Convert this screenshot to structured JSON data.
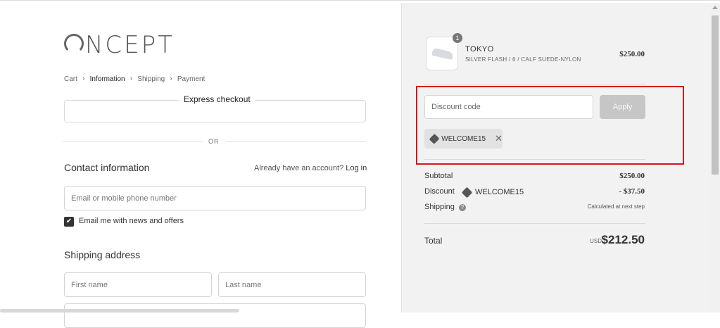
{
  "logo": {
    "text": "NCEPT"
  },
  "breadcrumb": [
    {
      "label": "Cart",
      "active": false
    },
    {
      "label": "Information",
      "active": true
    },
    {
      "label": "Shipping",
      "active": false
    },
    {
      "label": "Payment",
      "active": false
    }
  ],
  "express": {
    "label": "Express checkout",
    "or": "OR"
  },
  "contact": {
    "title": "Contact information",
    "login_prompt": "Already have an account?",
    "login_link": "Log in",
    "email_placeholder": "Email or mobile phone number",
    "newsletter_label": "Email me with news and offers",
    "newsletter_checked": true
  },
  "shipping": {
    "title": "Shipping address",
    "first_name_placeholder": "First name",
    "last_name_placeholder": "Last name"
  },
  "cart": {
    "quantity_badge": "1",
    "product_name": "TOKYO",
    "product_variant": "SILVER FLASH / 6 / CALF SUEDE-NYLON",
    "product_price": "$250.00"
  },
  "discount": {
    "placeholder": "Discount code",
    "apply_label": "Apply",
    "applied_code": "WELCOME15"
  },
  "summary": {
    "subtotal_label": "Subtotal",
    "subtotal_value": "$250.00",
    "discount_label": "Discount",
    "discount_code": "WELCOME15",
    "discount_value": "- $37.50",
    "shipping_label": "Shipping",
    "shipping_value": "Calculated at next step",
    "total_label": "Total",
    "currency": "USD",
    "total_value": "$212.50"
  },
  "colors": {
    "highlight": "#d6171b",
    "panel_bg": "#f2f2f2",
    "apply_bg": "#c6c6c6"
  },
  "icons": [
    "tag-icon",
    "close-icon",
    "question-icon",
    "checkmark-icon",
    "chevron-right-icon"
  ]
}
